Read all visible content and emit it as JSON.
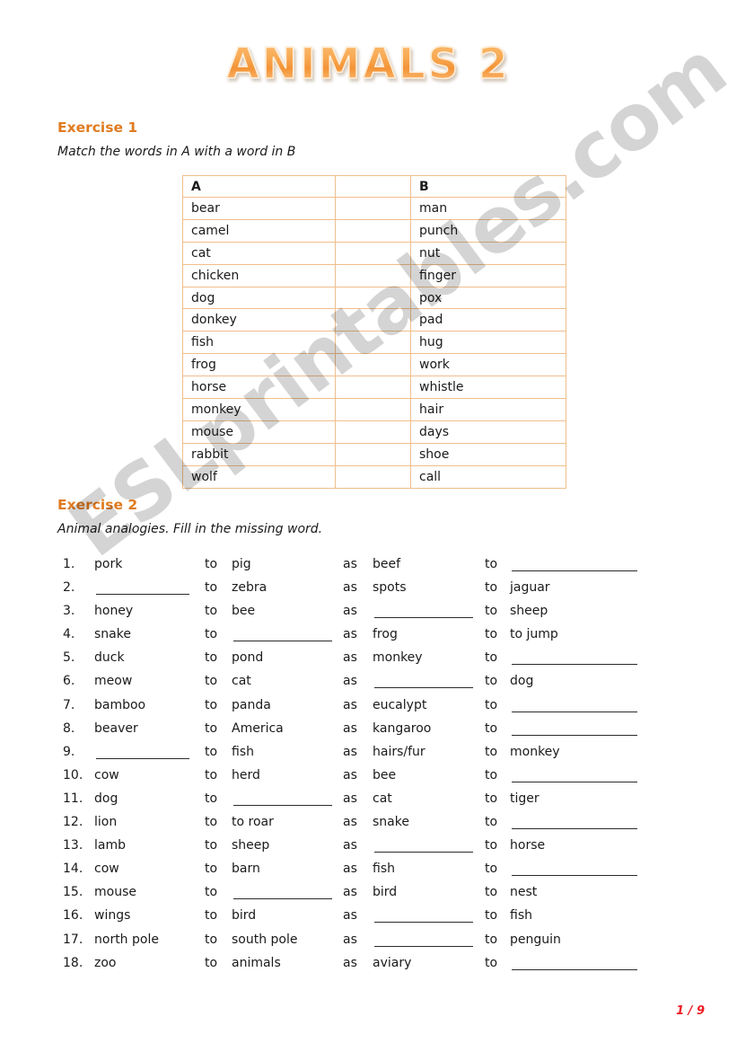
{
  "title": "ANIMALS 2",
  "watermark": "ESLprintables.com",
  "footer": {
    "page_label": "1 / 9"
  },
  "colors": {
    "title_orange": "#F39336",
    "heading_orange": "#E07B20",
    "table_border": "#EFBE8C",
    "footer_red": "#EE1C24",
    "text": "#1A1A1A"
  },
  "exercise1": {
    "heading": "Exercise 1",
    "instruction": "Match the words in A with a word in B",
    "table": {
      "headers": [
        "A",
        "",
        "B"
      ],
      "column_a": [
        "bear",
        "camel",
        "cat",
        "chicken",
        "dog",
        "donkey",
        "fish",
        "frog",
        "horse",
        "monkey",
        "mouse",
        "rabbit",
        "wolf"
      ],
      "column_b": [
        "man",
        "punch",
        "nut",
        "finger",
        "pox",
        "pad",
        "hug",
        "work",
        "whistle",
        "hair",
        "days",
        "shoe",
        "call"
      ]
    }
  },
  "exercise2": {
    "heading": "Exercise 2",
    "instruction": "Animal analogies. Fill in the missing word.",
    "connector_to": "to",
    "connector_as": "as",
    "rows": [
      {
        "num": "1.",
        "t1": "pork",
        "t2": "pig",
        "t3": "beef",
        "t4": ""
      },
      {
        "num": "2.",
        "t1": "",
        "t2": "zebra",
        "t3": "spots",
        "t4": "jaguar"
      },
      {
        "num": "3.",
        "t1": "honey",
        "t2": "bee",
        "t3": "",
        "t4": "sheep"
      },
      {
        "num": "4.",
        "t1": "snake",
        "t2": "",
        "t3": "frog",
        "t4": "to jump"
      },
      {
        "num": "5.",
        "t1": "duck",
        "t2": "pond",
        "t3": "monkey",
        "t4": ""
      },
      {
        "num": "6.",
        "t1": "meow",
        "t2": "cat",
        "t3": "",
        "t4": "dog"
      },
      {
        "num": "7.",
        "t1": "bamboo",
        "t2": "panda",
        "t3": "eucalypt",
        "t4": ""
      },
      {
        "num": "8.",
        "t1": "beaver",
        "t2": "America",
        "t3": "kangaroo",
        "t4": ""
      },
      {
        "num": "9.",
        "t1": "",
        "t2": "fish",
        "t3": "hairs/fur",
        "t4": "monkey"
      },
      {
        "num": "10.",
        "t1": "cow",
        "t2": "herd",
        "t3": "bee",
        "t4": ""
      },
      {
        "num": "11.",
        "t1": "dog",
        "t2": "",
        "t3": "cat",
        "t4": "tiger"
      },
      {
        "num": "12.",
        "t1": "lion",
        "t2": "to roar",
        "t3": "snake",
        "t4": ""
      },
      {
        "num": "13.",
        "t1": "lamb",
        "t2": "sheep",
        "t3": "",
        "t4": "horse"
      },
      {
        "num": "14.",
        "t1": "cow",
        "t2": "barn",
        "t3": "fish",
        "t4": ""
      },
      {
        "num": "15.",
        "t1": "mouse",
        "t2": "",
        "t3": "bird",
        "t4": "nest"
      },
      {
        "num": "16.",
        "t1": "wings",
        "t2": "bird",
        "t3": "",
        "t4": "fish"
      },
      {
        "num": "17.",
        "t1": "north pole",
        "t2": "south pole",
        "t3": "",
        "t4": "penguin"
      },
      {
        "num": "18.",
        "t1": "zoo",
        "t2": "animals",
        "t3": "aviary",
        "t4": ""
      }
    ]
  }
}
